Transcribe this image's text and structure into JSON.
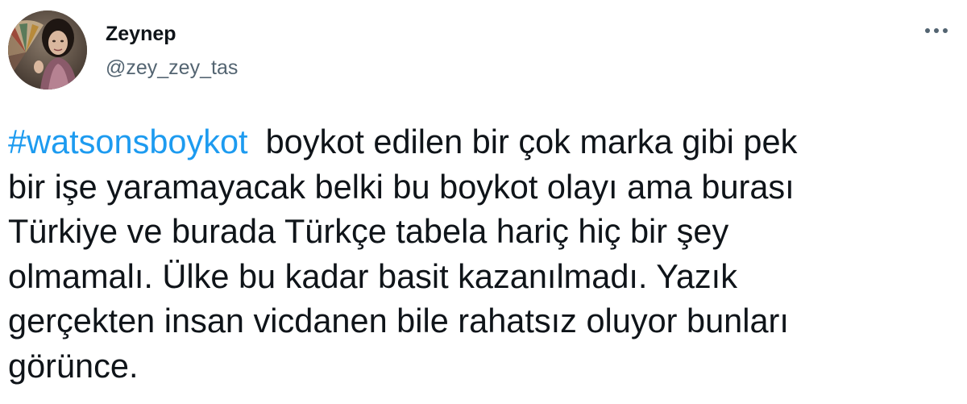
{
  "user": {
    "display_name": "Zeynep",
    "handle": "@zey_zey_tas",
    "avatar_icon": "profile-photo"
  },
  "actions": {
    "more_icon": "more-horizontal-icon"
  },
  "tweet": {
    "hashtag": "#watsonsboykot",
    "lines": [
      "boykot edilen bir çok marka gibi pek",
      "bir işe yaramayacak belki bu boykot olayı ama burası",
      "Türkiye ve burada Türkçe tabela hariç hiç bir şey",
      "olmamalı. Ülke bu kadar basit kazanılmadı. Yazık",
      "gerçekten insan vicdanen bile rahatsız oluyor bunları",
      "görünce."
    ]
  },
  "colors": {
    "text": "#0f1419",
    "secondary": "#536471",
    "link": "#1d9bf0",
    "background": "#ffffff"
  }
}
